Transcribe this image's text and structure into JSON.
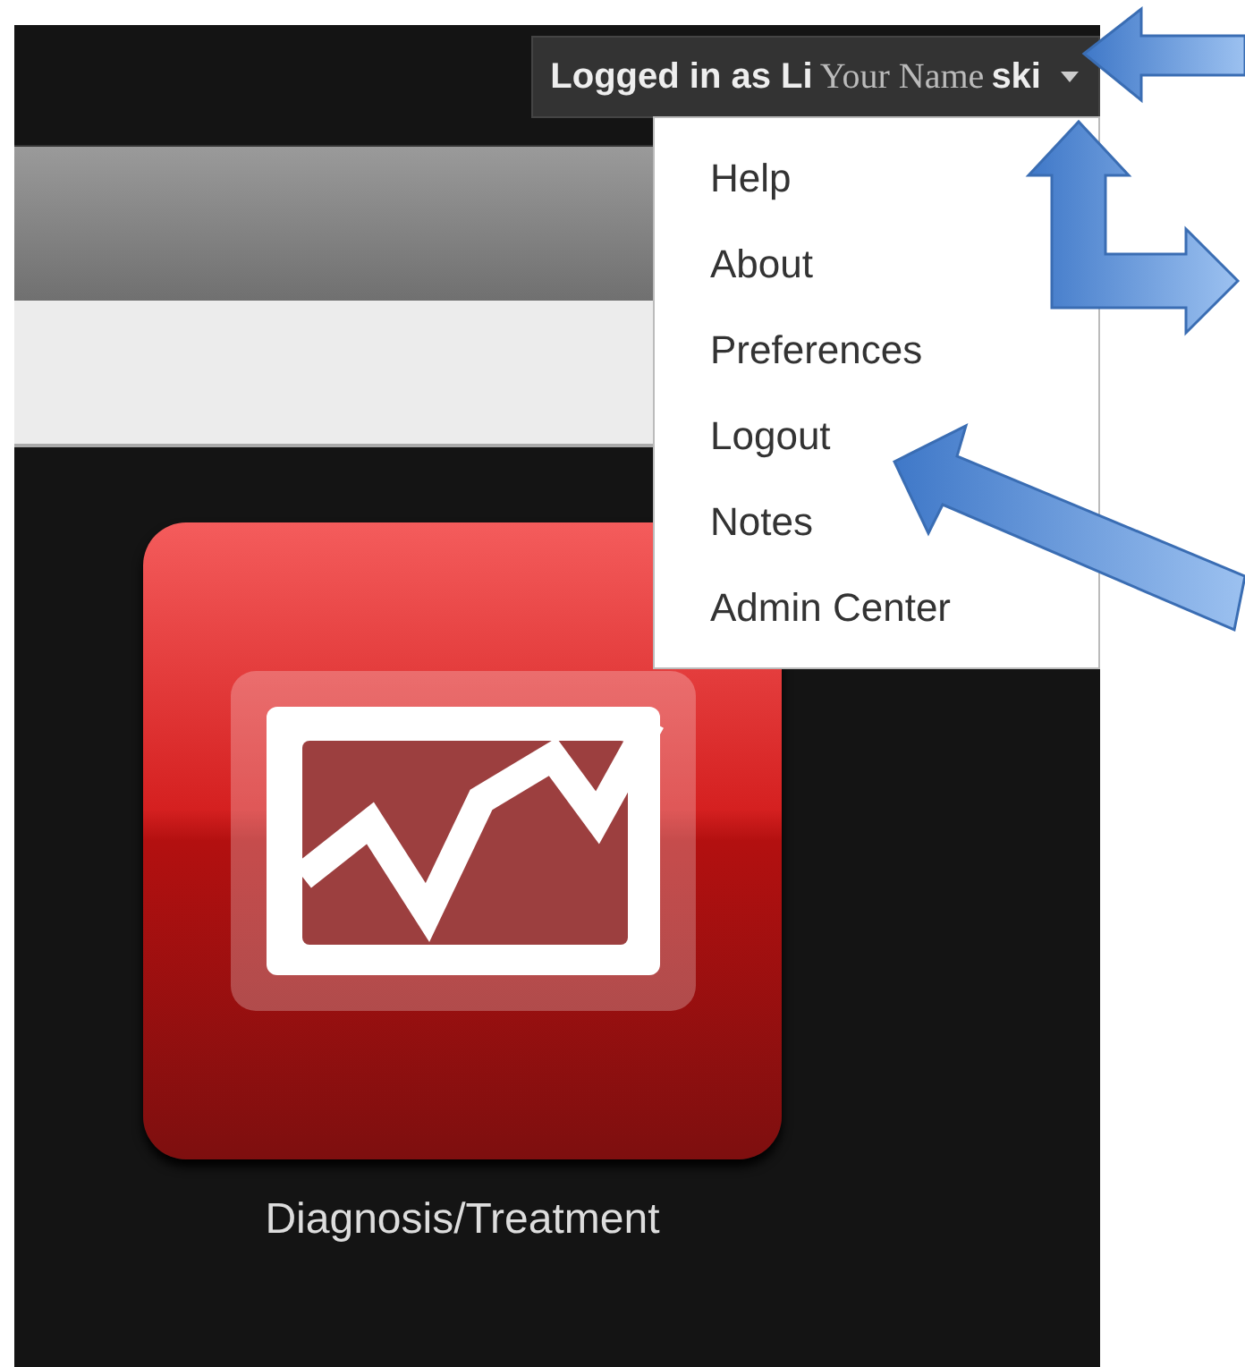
{
  "user_button": {
    "prefix": "Logged in as Li",
    "overlay_name": "Your Name",
    "suffix": "ski"
  },
  "menu": {
    "items": [
      {
        "label": "Help"
      },
      {
        "label": "About"
      },
      {
        "label": "Preferences"
      },
      {
        "label": "Logout"
      },
      {
        "label": "Notes"
      },
      {
        "label": "Admin Center"
      }
    ]
  },
  "tiles": [
    {
      "label": "Diagnosis/Treatment"
    }
  ]
}
